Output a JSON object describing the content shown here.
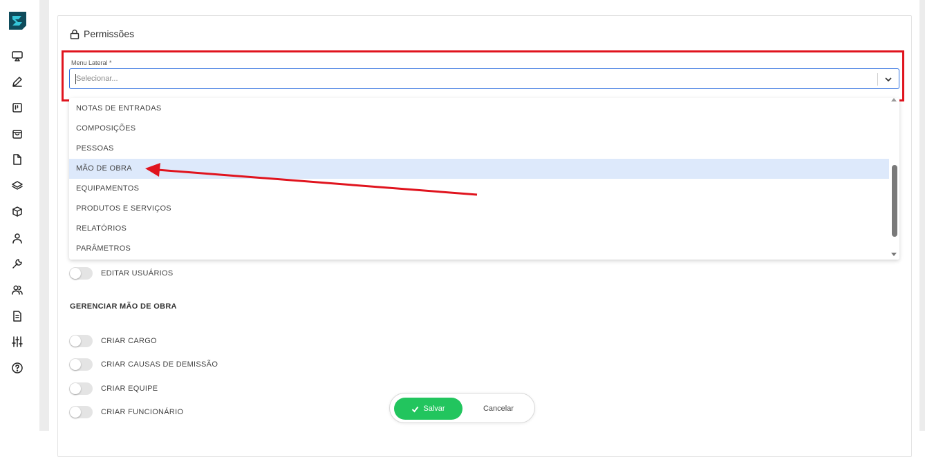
{
  "sidebar": {
    "logo": "rd-logo",
    "icons": [
      "monitor-icon",
      "pen-icon",
      "board-icon",
      "bag-icon",
      "file-icon",
      "layers-icon",
      "box-icon",
      "user-icon",
      "wrench-icon",
      "users-icon",
      "document-icon",
      "sliders-icon",
      "help-icon"
    ]
  },
  "section": {
    "title": "Permissões",
    "icon": "lock-icon"
  },
  "menu_field": {
    "label": "Menu Lateral *",
    "placeholder": "Selecionar...",
    "options": [
      "NOTAS DE ENTRADAS",
      "COMPOSIÇÕES",
      "PESSOAS",
      "MÃO DE OBRA",
      "EQUIPAMENTOS",
      "PRODUTOS E SERVIÇOS",
      "RELATÓRIOS",
      "PARÂMETROS"
    ],
    "highlighted_option": "MÃO DE OBRA"
  },
  "permissions": {
    "edit_users": "EDITAR USUÁRIOS",
    "group_title": "GERENCIAR MÃO DE OBRA",
    "items": [
      "CRIAR CARGO",
      "CRIAR CAUSAS DE DEMISSÃO",
      "CRIAR EQUIPE",
      "CRIAR FUNCIONÁRIO"
    ]
  },
  "actions": {
    "save": "Salvar",
    "cancel": "Cancelar"
  },
  "colors": {
    "accent": "#2e6fe0",
    "highlight_box": "#e0141e",
    "save_button": "#22c55e",
    "selected_option": "#dde9fb"
  }
}
